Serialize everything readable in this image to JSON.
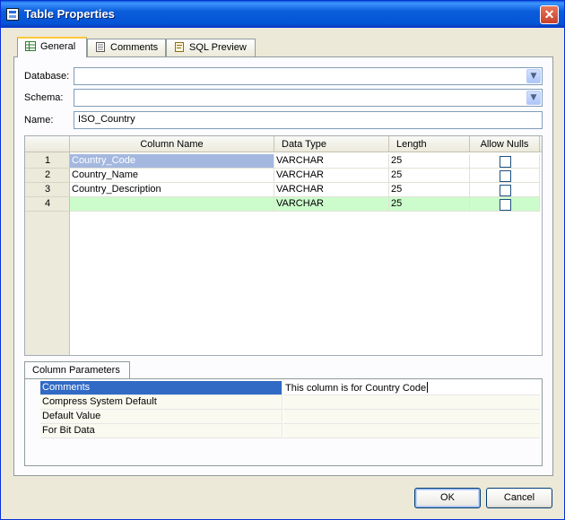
{
  "window": {
    "title": "Table Properties",
    "close_label": "✕"
  },
  "tabs": [
    {
      "label": "General",
      "icon": "grid-icon",
      "active": true
    },
    {
      "label": "Comments",
      "icon": "notepad-icon",
      "active": false
    },
    {
      "label": "SQL Preview",
      "icon": "sql-script-icon",
      "active": false
    }
  ],
  "form": {
    "database_label": "Database:",
    "database_value": "",
    "schema_label": "Schema:",
    "schema_value": "",
    "name_label": "Name:",
    "name_value": "ISO_Country"
  },
  "columns_grid": {
    "headers": [
      "Column Name",
      "Data Type",
      "Length",
      "Allow Nulls"
    ],
    "rows": [
      {
        "num": "1",
        "name": "Country_Code",
        "type": "VARCHAR",
        "length": "25",
        "allow_nulls": false
      },
      {
        "num": "2",
        "name": "Country_Name",
        "type": "VARCHAR",
        "length": "25",
        "allow_nulls": false
      },
      {
        "num": "3",
        "name": "Country_Description",
        "type": "VARCHAR",
        "length": "25",
        "allow_nulls": false
      },
      {
        "num": "4",
        "name": "",
        "type": "VARCHAR",
        "length": "25",
        "allow_nulls": false
      }
    ]
  },
  "column_parameters": {
    "tab_label": "Column Parameters",
    "rows": [
      {
        "name": "Comments",
        "value": "This column is for Country Code"
      },
      {
        "name": "Compress System Default",
        "value": ""
      },
      {
        "name": "Default Value",
        "value": ""
      },
      {
        "name": "For Bit Data",
        "value": ""
      }
    ]
  },
  "buttons": {
    "ok_label": "OK",
    "cancel_label": "Cancel"
  },
  "colors": {
    "title_bar": "#0a5fd8",
    "selection": "#316ac5",
    "new_row": "#ccfccc",
    "active_tab_accent": "#ffc83c"
  }
}
